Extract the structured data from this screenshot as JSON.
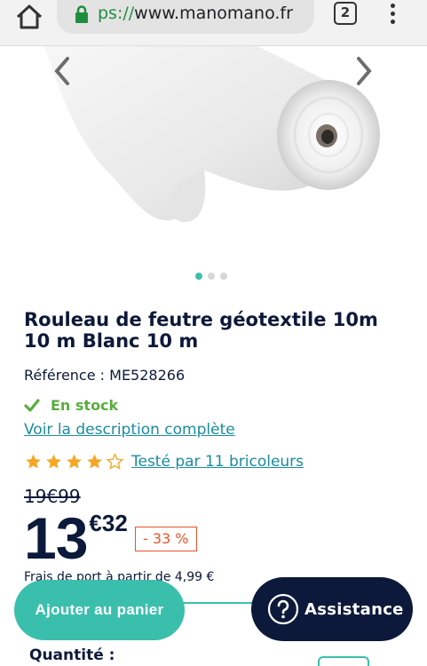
{
  "browser": {
    "url_scheme": "ps://",
    "url_host": "www.manomano.fr",
    "tab_count": "2"
  },
  "gallery": {
    "image_count": 3,
    "active_index": 0
  },
  "product": {
    "title": "Rouleau de feutre géotextile 10m 10 m Blanc 10 m",
    "reference": "Référence : ME528266",
    "stock": "En stock",
    "description_link": "Voir la description complète",
    "rating": 4,
    "rating_max": 5,
    "rating_link": "Testé par 11 bricoleurs",
    "old_price": "19€99",
    "price_int": "13",
    "price_dec": "€32",
    "discount": "- 33 %",
    "shipping": "Frais de port à partir de 4,99 €"
  },
  "actions": {
    "add_to_cart": "Ajouter au panier",
    "assistance": "Assistance",
    "quantity_label": "Quantité :"
  },
  "colors": {
    "teal": "#3bbfad",
    "navy": "#0c193a",
    "star": "#f5a623",
    "discount": "#e8532a",
    "stock": "#5aad3e",
    "link": "#1a8c9c"
  }
}
